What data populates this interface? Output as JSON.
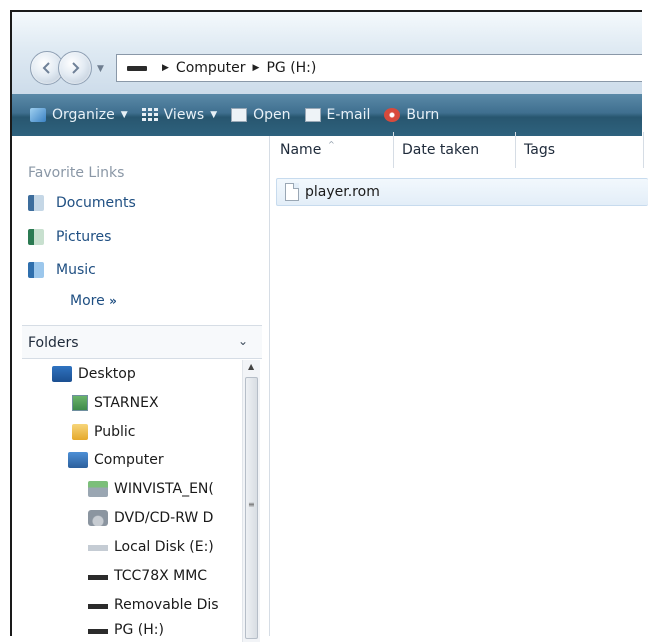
{
  "address_bar": {
    "crumbs": [
      "Computer",
      "PG (H:)"
    ]
  },
  "toolbar": {
    "organize": "Organize",
    "views": "Views",
    "open": "Open",
    "email": "E-mail",
    "burn": "Burn"
  },
  "favorite_links": {
    "heading": "Favorite Links",
    "items": [
      {
        "label": "Documents",
        "icon": "documents-icon"
      },
      {
        "label": "Pictures",
        "icon": "pictures-icon"
      },
      {
        "label": "Music",
        "icon": "music-icon"
      }
    ],
    "more": "More",
    "more_glyph": "»"
  },
  "folders": {
    "heading": "Folders",
    "tree": [
      {
        "label": "Desktop",
        "icon": "desktop-icon"
      },
      {
        "label": "STARNEX",
        "icon": "user-folder-icon"
      },
      {
        "label": "Public",
        "icon": "folder-icon"
      },
      {
        "label": "Computer",
        "icon": "computer-icon"
      },
      {
        "label": "WINVISTA_EN(",
        "icon": "network-drive-icon"
      },
      {
        "label": "DVD/CD-RW D",
        "icon": "dvd-drive-icon"
      },
      {
        "label": "Local Disk (E:)",
        "icon": "local-disk-icon"
      },
      {
        "label": "TCC78X MMC",
        "icon": "removable-drive-icon"
      },
      {
        "label": "Removable Dis",
        "icon": "removable-drive-icon"
      },
      {
        "label": "PG (H:)",
        "icon": "removable-drive-icon"
      }
    ]
  },
  "file_list": {
    "columns": [
      "Name",
      "Date taken",
      "Tags"
    ],
    "files": [
      {
        "name": "player.rom"
      }
    ]
  },
  "colors": {
    "toolbar": "#2e627e",
    "link": "#1f4f82",
    "selection": "#e3eef8"
  }
}
